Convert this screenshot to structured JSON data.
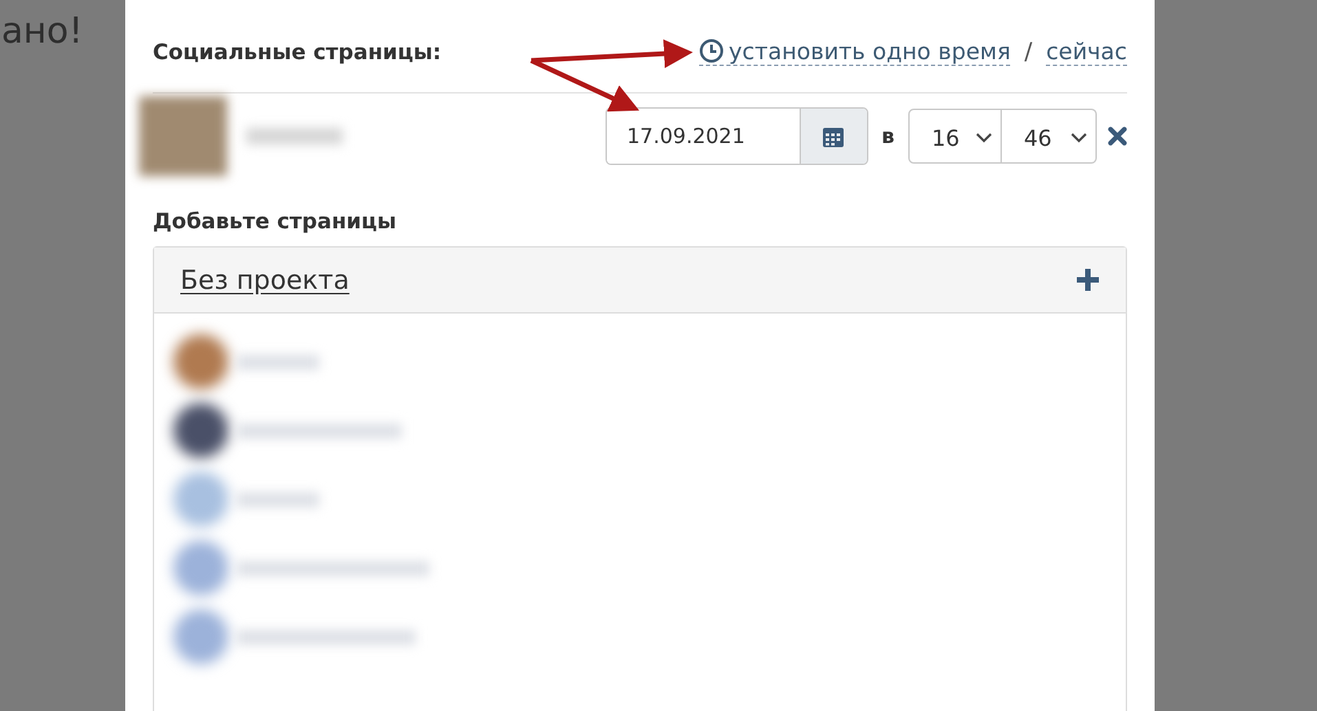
{
  "background_text": "ано!",
  "section_title": "Социальные страницы:",
  "set_one_time_link": "установить одно время",
  "separator": "/",
  "now_link": "сейчас",
  "schedule": {
    "date": "17.09.2021",
    "at_label": "в",
    "hour": "16",
    "minute": "46"
  },
  "add_pages_title": "Добавьте страницы",
  "project": {
    "name": "Без проекта"
  }
}
